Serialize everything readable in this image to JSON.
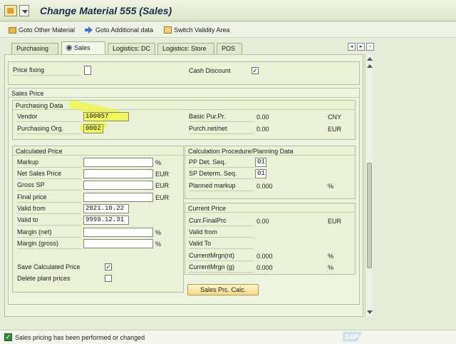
{
  "window": {
    "title": "Change Material 555 (Sales)"
  },
  "toolbar": {
    "goto_other_material": "Goto Other Material",
    "goto_additional_data": "Goto Additional data",
    "switch_validity_area": "Switch Validity Area"
  },
  "tabs": [
    {
      "label": "Purchasing",
      "active": false
    },
    {
      "label": "Sales",
      "active": true
    },
    {
      "label": "Logistics: DC",
      "active": false
    },
    {
      "label": "Logistics: Store",
      "active": false
    },
    {
      "label": "POS",
      "active": false
    }
  ],
  "top_section": {
    "price_fixing_label": "Price fixing",
    "price_fixing_checked": false,
    "cash_discount_label": "Cash Discount",
    "cash_discount_checked": true
  },
  "sales_price": {
    "title": "Sales Price",
    "purchasing_data": {
      "title": "Purchasing Data",
      "vendor_label": "Vendor",
      "vendor_value": "100057",
      "purch_org_label": "Purchasing Org.",
      "purch_org_value": "0002",
      "basic_pur_pr_label": "Basic Pur.Pr.",
      "basic_pur_pr_value": "0.00",
      "basic_pur_pr_currency": "CNY",
      "purch_net_label": "Purch.net/net",
      "purch_net_value": "0.00",
      "purch_net_currency": "EUR"
    },
    "calculated_price": {
      "title": "Calculated Price",
      "markup_label": "Markup",
      "markup_value": "",
      "markup_unit": "%",
      "net_sales_price_label": "Net Sales Price",
      "net_sales_price_value": "",
      "net_sales_price_unit": "EUR",
      "gross_sp_label": "Gross SP",
      "gross_sp_value": "",
      "gross_sp_unit": "EUR",
      "final_price_label": "Final price",
      "final_price_value": "",
      "final_price_unit": "EUR",
      "valid_from_label": "Valid from",
      "valid_from_value": "2021.10.22",
      "valid_to_label": "Valid to",
      "valid_to_value": "9999.12.31",
      "margin_net_label": "Margin (net)",
      "margin_net_value": "",
      "margin_net_unit": "%",
      "margin_gross_label": "Margin (gross)",
      "margin_gross_value": "",
      "margin_gross_unit": "%",
      "save_calc_label": "Save Calculated Price",
      "save_calc_checked": true,
      "delete_plant_label": "Delete plant prices",
      "delete_plant_checked": false
    },
    "calc_procedure": {
      "title": "Calculation Procedure/Planning Data",
      "pp_det_seq_label": "PP Det. Seq.",
      "pp_det_seq_value": "01",
      "sp_determ_seq_label": "SP Determ. Seq.",
      "sp_determ_seq_value": "01",
      "planned_markup_label": "Planned markup",
      "planned_markup_value": "0.000",
      "planned_markup_unit": "%"
    },
    "current_price": {
      "title": "Current Price",
      "curr_final_prc_label": "Curr.FinalPrc",
      "curr_final_prc_value": "0.00",
      "curr_final_prc_currency": "EUR",
      "valid_from_label": "Valid from",
      "valid_to_label": "Valid To",
      "curr_mrgn_nt_label": "CurrentMrgn(nt)",
      "curr_mrgn_nt_value": "0.000",
      "curr_mrgn_nt_unit": "%",
      "curr_mrgn_g_label": "CurrentMrgn (g)",
      "curr_mrgn_g_value": "0.000",
      "curr_mrgn_g_unit": "%"
    },
    "sales_prc_calc_button": "Sales Prc. Calc."
  },
  "status": {
    "message": "Sales pricing has been performed or changed"
  },
  "branding": {
    "logo_text": "SAP"
  },
  "colors": {
    "highlight": "#f3f85a",
    "status_ok": "#2e8b3c"
  }
}
